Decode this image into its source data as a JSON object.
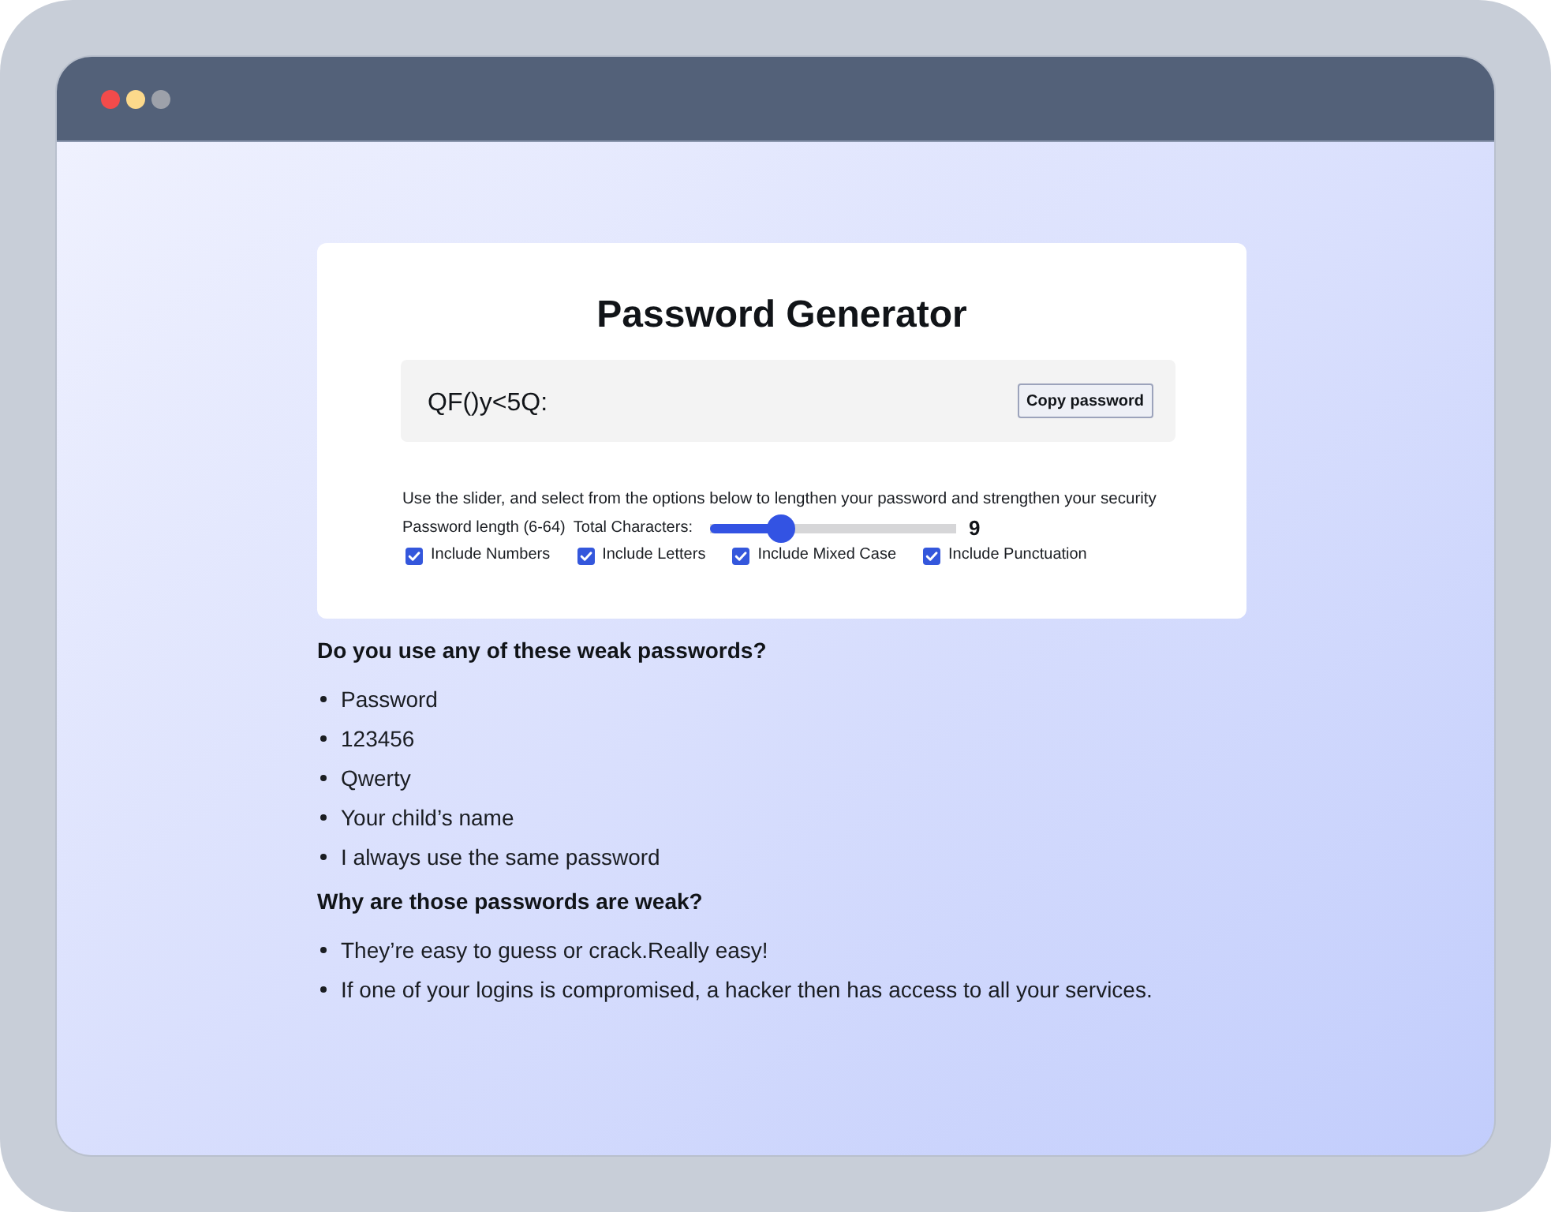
{
  "window": {
    "controls": [
      {
        "color": "#f24b4b"
      },
      {
        "color": "#fcd98b"
      },
      {
        "color": "#9da1aa"
      }
    ]
  },
  "generator": {
    "title": "Password Generator",
    "password": "QF()y<5Q:",
    "copy_button": "Copy password",
    "instructions": "Use the slider, and select from the options below to lengthen your password and strengthen your security",
    "length_label": "Password length (6-64)",
    "total_label": "Total Characters:",
    "slider": {
      "level": 0.29
    },
    "length_value": "9",
    "options": [
      {
        "label": "Include Numbers",
        "checked": true
      },
      {
        "label": "Include Letters",
        "checked": true
      },
      {
        "label": "Include Mixed Case",
        "checked": true
      },
      {
        "label": "Include Punctuation",
        "checked": true
      }
    ]
  },
  "sections": [
    {
      "heading": "Do you use any of these weak passwords?",
      "items": [
        "Password",
        "123456",
        "Qwerty",
        "Your child’s name",
        "I always use the same password"
      ]
    },
    {
      "heading": "Why are those passwords are weak?",
      "items": [
        "They’re easy to guess or crack.Really easy!",
        "If one of your logins is compromised, a hacker then has access to all your services."
      ]
    }
  ]
}
